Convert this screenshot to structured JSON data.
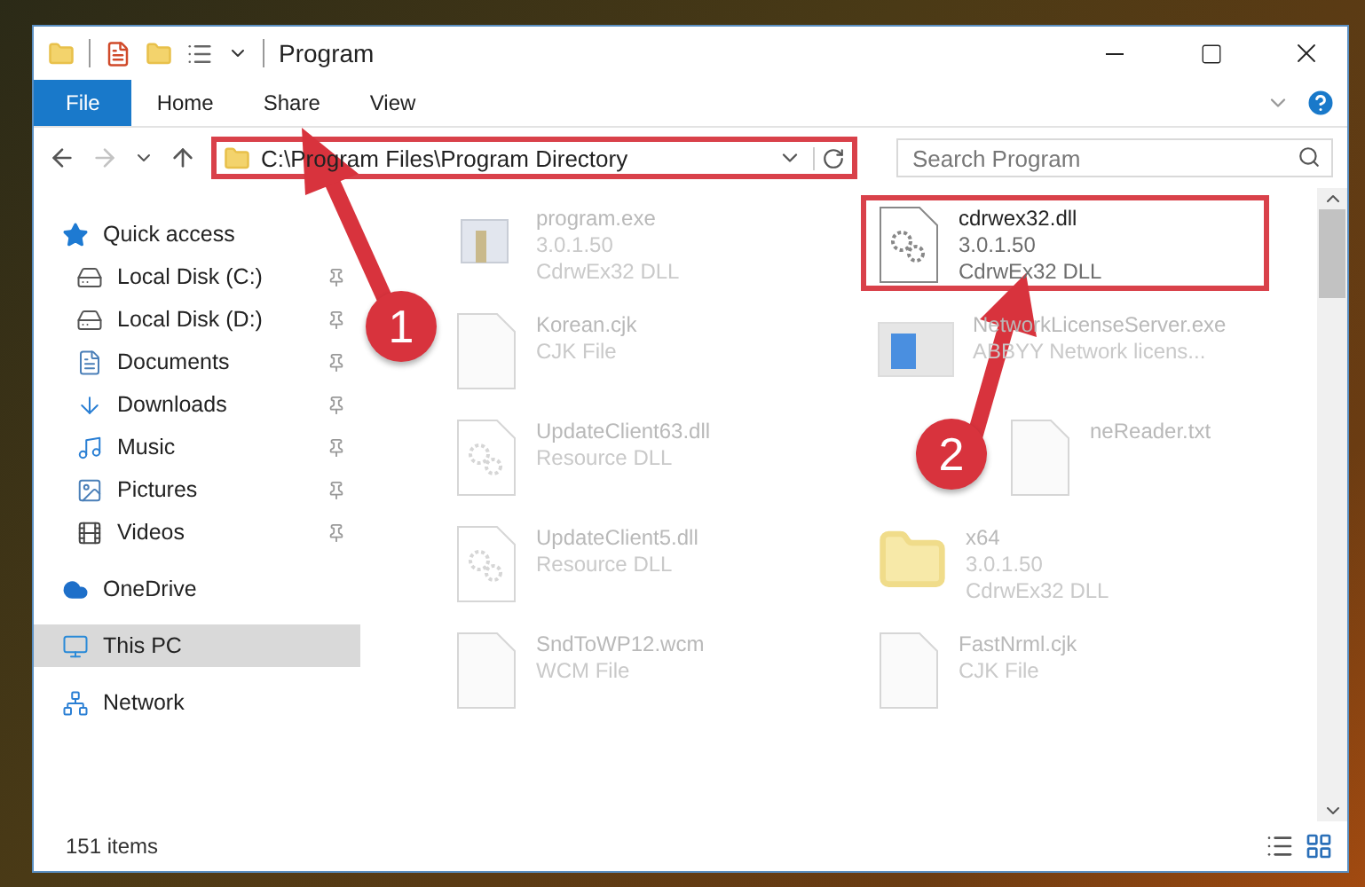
{
  "window": {
    "title": "Program"
  },
  "ribbon_tabs": [
    {
      "label": "File",
      "selected": true
    },
    {
      "label": "Home",
      "selected": false
    },
    {
      "label": "Share",
      "selected": false
    },
    {
      "label": "View",
      "selected": false
    }
  ],
  "address": {
    "path": "C:\\Program Files\\Program Directory",
    "highlighted": true
  },
  "search": {
    "placeholder": "Search Program"
  },
  "sidebar": {
    "items": [
      {
        "label": "Quick access",
        "kind": "group",
        "selected": false,
        "children": [
          {
            "label": "Local Disk (C:)",
            "kind": "drive-c",
            "pinned": true,
            "selected": false
          },
          {
            "label": "Local Disk (D:)",
            "kind": "drive",
            "pinned": true,
            "selected": false
          },
          {
            "label": "Documents",
            "kind": "documents",
            "pinned": true,
            "selected": false
          },
          {
            "label": "Downloads",
            "kind": "downloads",
            "pinned": true,
            "selected": false
          },
          {
            "label": "Music",
            "kind": "music",
            "pinned": true,
            "selected": false
          },
          {
            "label": "Pictures",
            "kind": "pictures",
            "pinned": true,
            "selected": false
          },
          {
            "label": "Videos",
            "kind": "videos",
            "pinned": true,
            "selected": false
          }
        ]
      },
      {
        "label": "OneDrive",
        "kind": "cloud",
        "selected": false
      },
      {
        "label": "This PC",
        "kind": "pc",
        "selected": true
      },
      {
        "label": "Network",
        "kind": "network",
        "selected": false
      }
    ]
  },
  "files": [
    {
      "name": "program.exe",
      "details": [
        "3.0.1.50",
        "CdrwEx32 DLL"
      ],
      "kind": "app",
      "highlighted": false
    },
    {
      "name": "cdrwex32.dll",
      "details": [
        "3.0.1.50",
        "CdrwEx32 DLL"
      ],
      "kind": "gears",
      "highlighted": true
    },
    {
      "name": "Korean.cjk",
      "details": [
        "CJK File"
      ],
      "kind": "blank",
      "highlighted": false
    },
    {
      "name": "NetworkLicenseServer.exe",
      "details": [
        "ABBYY Network licens..."
      ],
      "kind": "window",
      "highlighted": false
    },
    {
      "name": "UpdateClient63.dll",
      "details": [
        "Resource DLL"
      ],
      "kind": "gears",
      "highlighted": false
    },
    {
      "name": "neReader.txt",
      "kind": "blank",
      "highlighted": false
    },
    {
      "name": "UpdateClient5.dll",
      "details": [
        "Resource DLL"
      ],
      "kind": "gears",
      "highlighted": false
    },
    {
      "name": "x64",
      "details": [
        "3.0.1.50",
        "CdrwEx32 DLL"
      ],
      "kind": "folder",
      "highlighted": false
    },
    {
      "name": "SndToWP12.wcm",
      "details": [
        "WCM File"
      ],
      "kind": "blank",
      "highlighted": false
    },
    {
      "name": "FastNrml.cjk",
      "details": [
        "CJK File"
      ],
      "kind": "blank",
      "highlighted": false
    }
  ],
  "annotations": [
    {
      "label": "1"
    },
    {
      "label": "2"
    }
  ],
  "status_bar": {
    "count": "151 items"
  }
}
